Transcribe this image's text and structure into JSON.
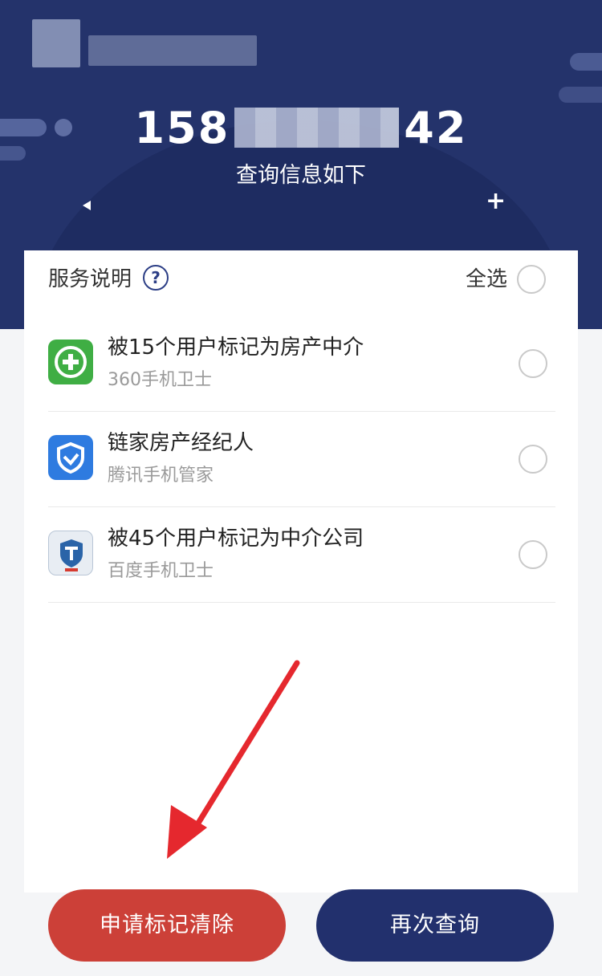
{
  "header": {
    "phone_prefix": "158",
    "phone_suffix": "42",
    "subtitle": "查询信息如下"
  },
  "card": {
    "service_label": "服务说明",
    "help_icon_glyph": "?",
    "select_all_label": "全选"
  },
  "items": [
    {
      "title": "被15个用户标记为房产中介",
      "source": "360手机卫士",
      "icon": "shield-plus-icon",
      "icon_color": "#3fae44"
    },
    {
      "title": "链家房产经纪人",
      "source": "腾讯手机管家",
      "icon": "shield-check-icon",
      "icon_color": "#2e7be0"
    },
    {
      "title": "被45个用户标记为中介公司",
      "source": "百度手机卫士",
      "icon": "shield-t-icon",
      "icon_color": "#2a64a8"
    }
  ],
  "buttons": {
    "clear_label": "申请标记清除",
    "requery_label": "再次查询"
  },
  "colors": {
    "header_bg": "#24336b",
    "accent_red": "#cc4038",
    "accent_navy": "#22306d",
    "annotation_arrow": "#e5282e"
  }
}
